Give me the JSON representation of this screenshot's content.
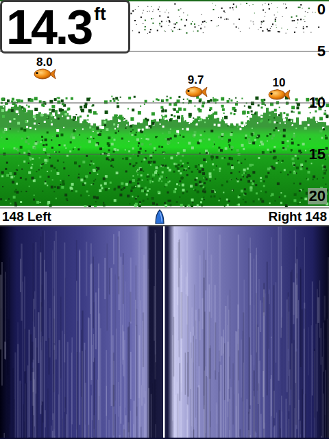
{
  "depth_readout": {
    "value": "14.3",
    "unit": "ft"
  },
  "depth_scale": {
    "ticks": [
      "0",
      "5",
      "10",
      "15",
      "20"
    ],
    "max_depth": 20
  },
  "fish": [
    {
      "label": "8.0",
      "depth": 8.0,
      "time": 0.135
    },
    {
      "label": "9.7",
      "depth": 9.7,
      "time": 0.595
    },
    {
      "label": "10",
      "depth": 10,
      "time": 0.848
    }
  ],
  "bottom": {
    "depth": 14.3,
    "vegetation_top": [
      10.6,
      10.3,
      10.9,
      11.2,
      10.8,
      11.5,
      11.8,
      12.0,
      11.6,
      11.9,
      12.1,
      11.7,
      11.4,
      11.8,
      11.2,
      11.5,
      11.9,
      12.2,
      11.0,
      10.7,
      11.3,
      11.8,
      11.5,
      11.9
    ]
  },
  "side_imaging": {
    "left": "148 Left",
    "right": "Right 148"
  }
}
